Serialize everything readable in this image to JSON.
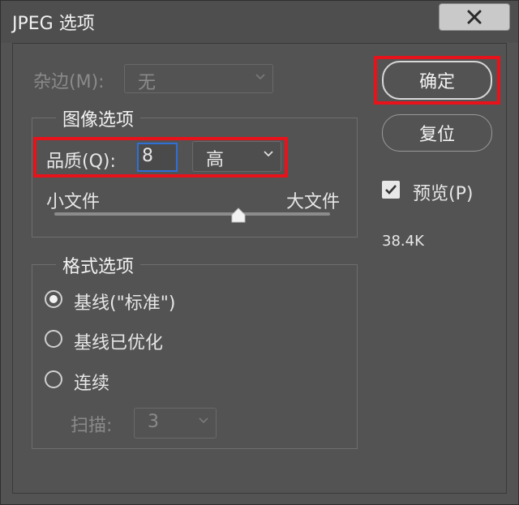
{
  "window": {
    "title": "JPEG 选项"
  },
  "matte": {
    "label": "杂边(M):",
    "value": "无"
  },
  "image_options": {
    "legend": "图像选项",
    "quality_label": "品质(Q):",
    "quality_value": "8",
    "quality_preset": "高",
    "small_file": "小文件",
    "large_file": "大文件",
    "slider_level": 8,
    "slider_max": 12
  },
  "format_options": {
    "legend": "格式选项",
    "baseline_standard": "基线(\"标准\")",
    "baseline_optimized": "基线已优化",
    "progressive": "连续",
    "selected": "baseline_standard",
    "scans_label": "扫描:",
    "scans_value": "3"
  },
  "buttons": {
    "ok": "确定",
    "reset": "复位"
  },
  "preview": {
    "label": "预览(P)",
    "checked": true
  },
  "file_size": "38.4K",
  "colors": {
    "highlight": "#e8121b",
    "focus": "#2f6fd8"
  }
}
